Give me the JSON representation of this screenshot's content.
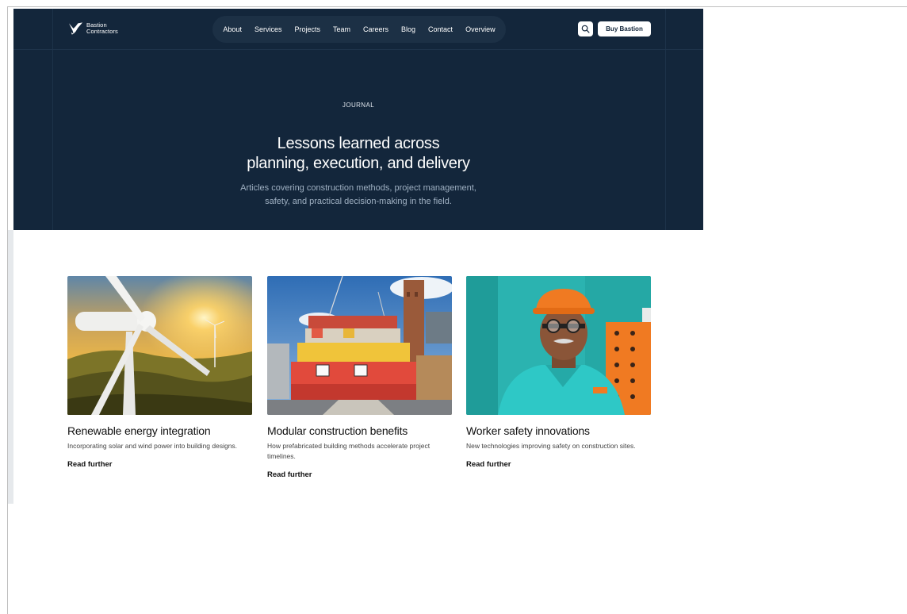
{
  "brand": {
    "line1": "Bastion",
    "line2": "Contractors"
  },
  "nav": [
    "About",
    "Services",
    "Projects",
    "Team",
    "Careers",
    "Blog",
    "Contact",
    "Overview"
  ],
  "header": {
    "cta_label": "Buy Bastion",
    "search_icon": "search-icon"
  },
  "hero": {
    "eyebrow": "JOURNAL",
    "title_line1": "Lessons learned across",
    "title_line2": "planning, execution, and delivery",
    "subtitle_line1": "Articles covering construction methods, project management,",
    "subtitle_line2": "safety, and practical decision-making in the field."
  },
  "colors": {
    "hero_bg": "#13263b",
    "nav_pill": "#1c3045",
    "accent_orange": "#f07a22"
  },
  "articles": [
    {
      "title": "Renewable energy integration",
      "description": "Incorporating solar and wind power into building designs.",
      "link": "Read further",
      "image": "wind-turbine-sunset-image"
    },
    {
      "title": "Modular construction benefits",
      "description": "How prefabricated building methods accelerate project timelines.",
      "link": "Read further",
      "image": "shipping-container-building-image"
    },
    {
      "title": "Worker safety innovations",
      "description": "New technologies improving safety on construction sites.",
      "link": "Read further",
      "image": "worker-hardhat-portrait-image"
    }
  ]
}
